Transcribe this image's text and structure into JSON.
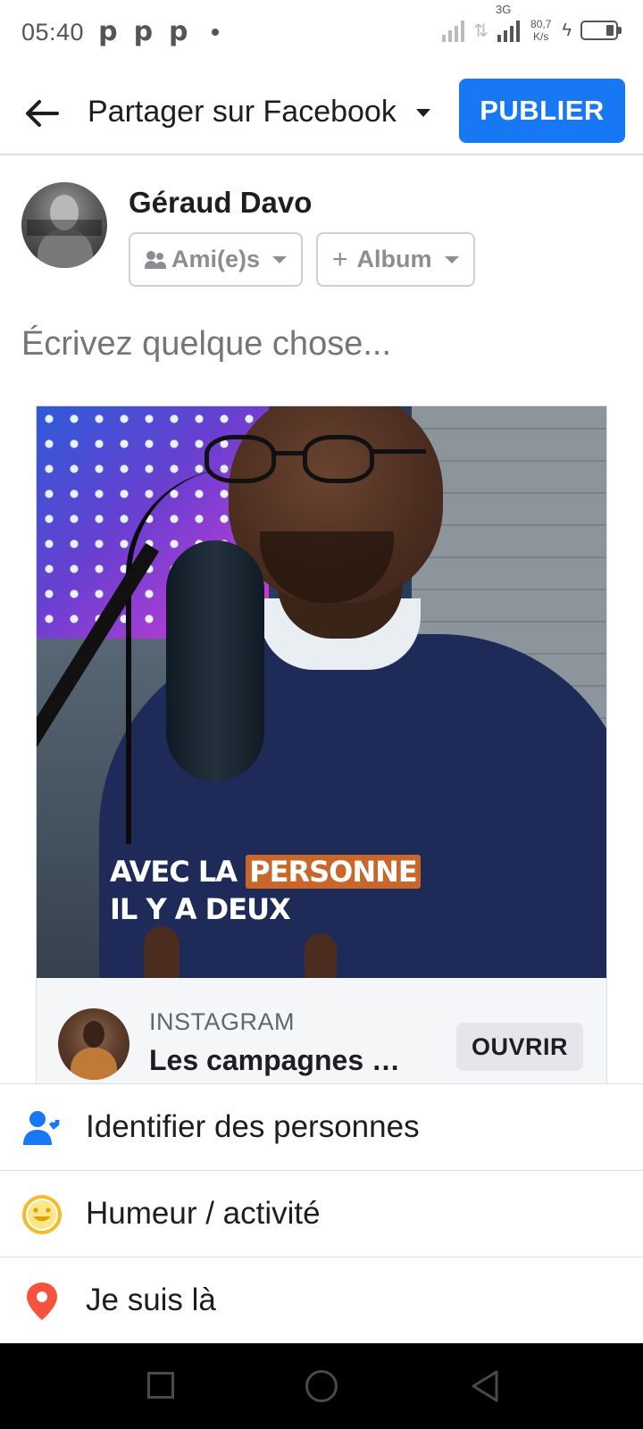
{
  "status_bar": {
    "time": "05:40",
    "notification_icons": [
      "p",
      "p",
      "p"
    ],
    "network_type": "3G",
    "speed_value": "80,7",
    "speed_unit": "K/s"
  },
  "header": {
    "title": "Partager sur Facebook",
    "publish_label": "PUBLIER"
  },
  "author": {
    "name": "Géraud Davo",
    "audience_label": "Ami(e)s",
    "album_label": "Album"
  },
  "composer": {
    "placeholder": "Écrivez quelque chose..."
  },
  "shared_post": {
    "caption_line1_prefix": "AVEC LA ",
    "caption_line1_highlight": "PERSONNE",
    "caption_line2": "IL Y A DEUX",
    "source": "INSTAGRAM",
    "title": "Les campagnes publicitaires",
    "open_label": "OUVRIR"
  },
  "options": [
    {
      "label": "Identifier des personnes",
      "icon": "tag-people-icon",
      "color": "#1877f2"
    },
    {
      "label": "Humeur / activité",
      "icon": "smiley-icon",
      "color": "#f7b928"
    },
    {
      "label": "Je suis là",
      "icon": "location-pin-icon",
      "color": "#f5533d"
    }
  ],
  "colors": {
    "accent": "#1877f2",
    "highlight": "#c9672a"
  }
}
